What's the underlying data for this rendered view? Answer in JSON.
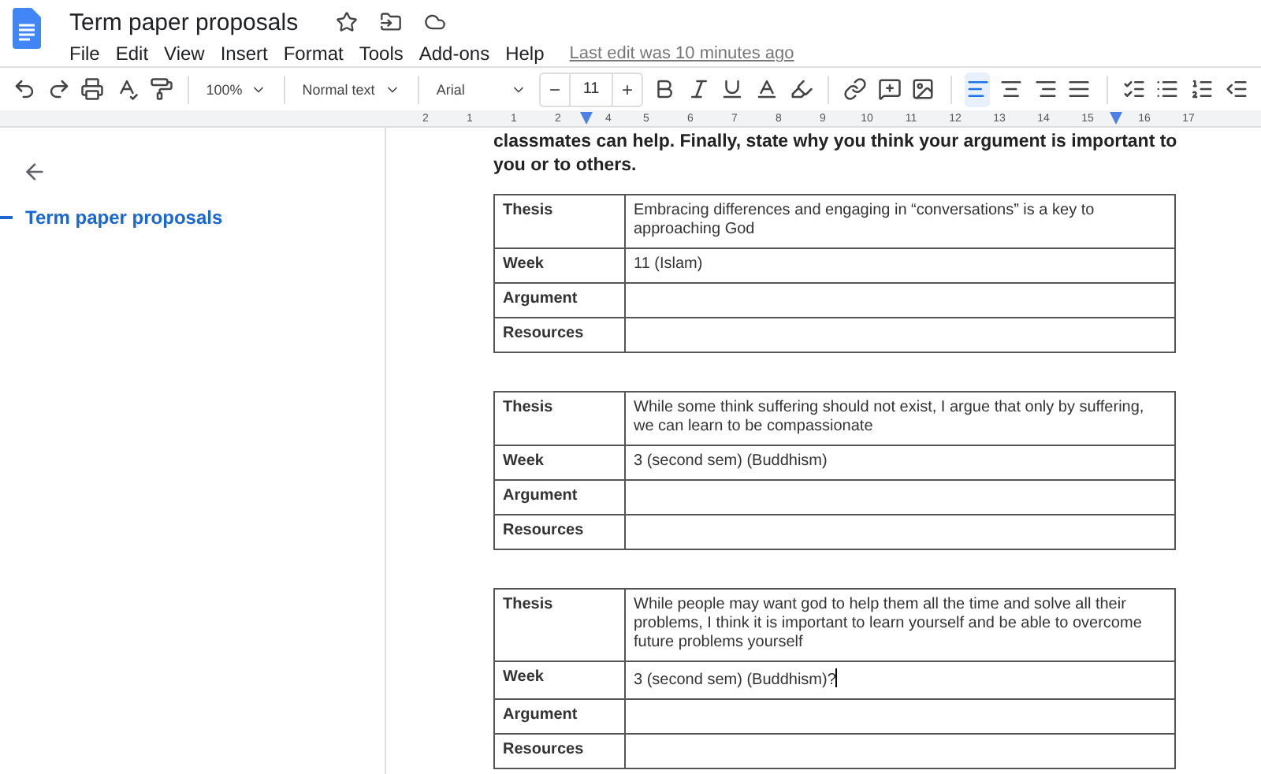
{
  "document": {
    "title": "Term paper proposals",
    "last_edit": "Last edit was 10 minutes ago"
  },
  "menu": [
    "File",
    "Edit",
    "View",
    "Insert",
    "Format",
    "Tools",
    "Add-ons",
    "Help"
  ],
  "toolbar": {
    "zoom": "100%",
    "style": "Normal text",
    "font": "Arial",
    "decrease": "−",
    "size": "11",
    "increase": "+",
    "alignment": [
      {
        "kind": "left",
        "selected": true
      },
      {
        "kind": "center",
        "selected": false
      },
      {
        "kind": "right",
        "selected": false
      },
      {
        "kind": "justify",
        "selected": false
      }
    ]
  },
  "ruler": [
    "2",
    "1",
    "1",
    "2",
    "4",
    "5",
    "6",
    "7",
    "8",
    "9",
    "10",
    "11",
    "12",
    "13",
    "14",
    "15",
    "16",
    "17"
  ],
  "outline": {
    "items": [
      {
        "label": "Term paper proposals",
        "selected": true
      }
    ]
  },
  "intro": "classmates can help. Finally, state why you think your argument is important to you or to others.",
  "tables": [
    {
      "rows": [
        {
          "label": "Thesis",
          "value": "Embracing differences and engaging in “conversations” is a key to approaching God"
        },
        {
          "label": "Week",
          "value": "11 (Islam)"
        },
        {
          "label": "Argument"
        },
        {
          "label": "Resources"
        }
      ]
    },
    {
      "rows": [
        {
          "label": "Thesis",
          "value": "While some think suffering should not exist, I argue that only by suffering, we can learn to be compassionate"
        },
        {
          "label": "Week",
          "value": "3 (second sem) (Buddhism)"
        },
        {
          "label": "Argument"
        },
        {
          "label": "Resources"
        }
      ]
    },
    {
      "rows": [
        {
          "label": "Thesis",
          "value": "While people may want god to help them all the time and solve all their problems, I think it is important to learn yourself and be able to overcome future problems yourself"
        },
        {
          "label": "Week",
          "value": "3 (second sem) (Buddhism)?",
          "cursor": true
        },
        {
          "label": "Argument"
        },
        {
          "label": "Resources"
        }
      ]
    }
  ]
}
